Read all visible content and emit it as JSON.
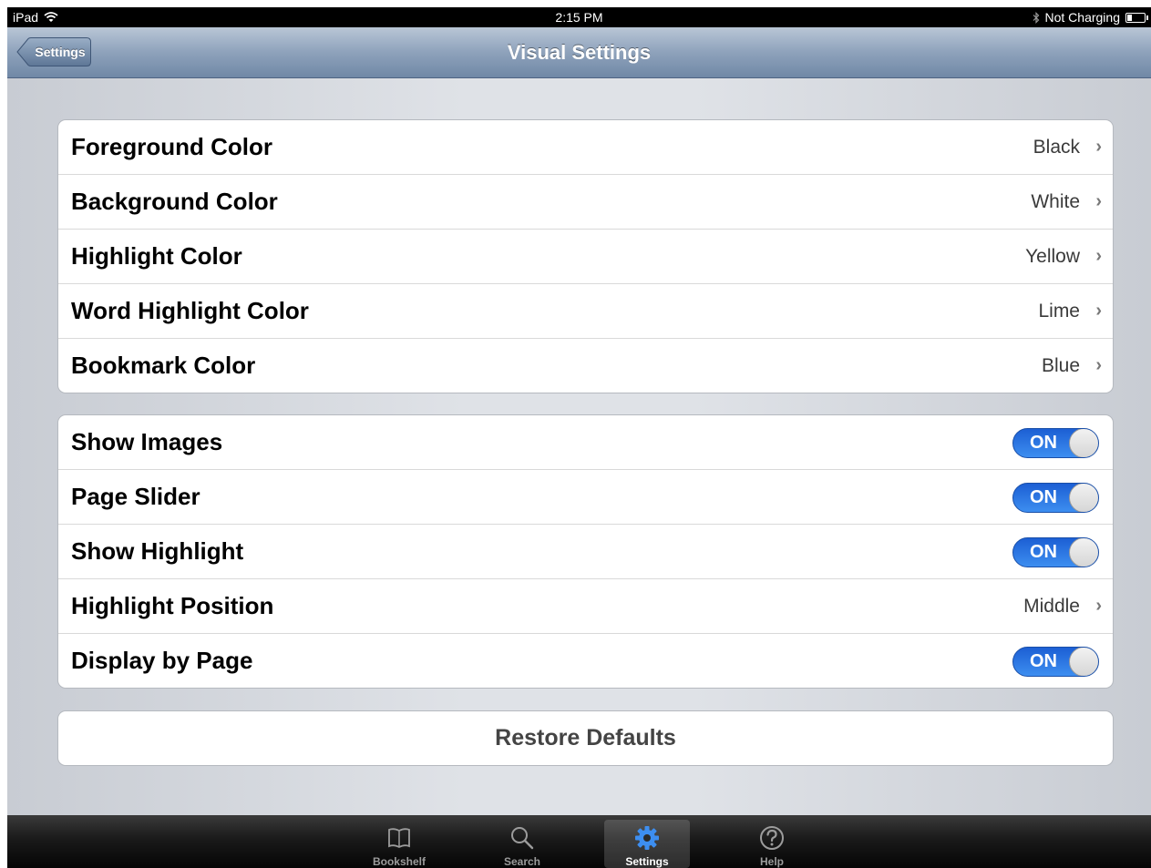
{
  "status_bar": {
    "device": "iPad",
    "time": "2:15 PM",
    "charging": "Not Charging",
    "icons": [
      "wifi-icon",
      "bluetooth-icon",
      "battery-icon"
    ]
  },
  "nav": {
    "back_label": "Settings",
    "title": "Visual Settings"
  },
  "color_settings": [
    {
      "title": "Foreground Color",
      "value": "Black"
    },
    {
      "title": "Background Color",
      "value": "White"
    },
    {
      "title": "Highlight Color",
      "value": "Yellow"
    },
    {
      "title": "Word Highlight Color",
      "value": "Lime"
    },
    {
      "title": "Bookmark Color",
      "value": "Blue"
    }
  ],
  "display_settings": [
    {
      "title": "Show Images",
      "type": "toggle",
      "value": "ON"
    },
    {
      "title": "Page Slider",
      "type": "toggle",
      "value": "ON"
    },
    {
      "title": "Show Highlight",
      "type": "toggle",
      "value": "ON"
    },
    {
      "title": "Highlight Position",
      "type": "disclosure",
      "value": "Middle"
    },
    {
      "title": "Display by Page",
      "type": "toggle",
      "value": "ON"
    }
  ],
  "restore_label": "Restore Defaults",
  "tabs": [
    {
      "label": "Bookshelf",
      "icon": "book-icon",
      "active": false
    },
    {
      "label": "Search",
      "icon": "search-icon",
      "active": false
    },
    {
      "label": "Settings",
      "icon": "gear-icon",
      "active": true
    },
    {
      "label": "Help",
      "icon": "help-icon",
      "active": false
    }
  ],
  "colors": {
    "toggle_on": "#2f7de8",
    "nav_bar": "#8ea2bb",
    "gear_active": "#3d8ef0"
  }
}
